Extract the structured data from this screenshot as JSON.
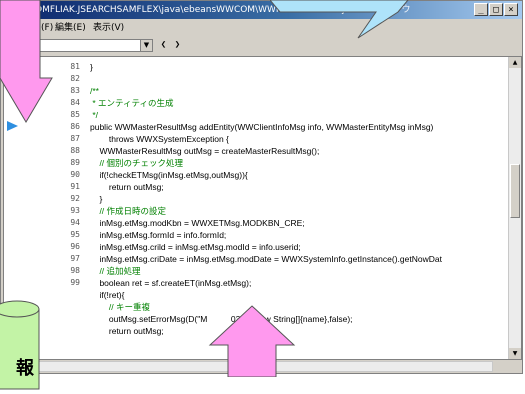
{
  "window": {
    "title": "OMFLIAK.JSEARCHSAMFLEX\\java\\ebeansWWCOM\\WWMasterInvoker.java",
    "title_suffix": "ソースウィンドウ",
    "minimize": "_",
    "maximize": "□",
    "close": "×"
  },
  "menu": [
    {
      "label": "ファイル(F)"
    },
    {
      "label": "編集(E)"
    },
    {
      "label": "表示(V)"
    }
  ],
  "toolbar": {
    "combo_value": "",
    "combo_arrow": "▼",
    "btn_prev": "❮",
    "btn_next": "❯"
  },
  "editor": {
    "current_line": "85",
    "lines": [
      {
        "no": "81",
        "text": "}",
        "type": "code"
      },
      {
        "no": "82",
        "text": "",
        "type": "code"
      },
      {
        "no": "83",
        "text": "/**",
        "type": "comment"
      },
      {
        "no": "84",
        "text": " * エンティティの生成",
        "type": "comment"
      },
      {
        "no": "85",
        "text": " */",
        "type": "comment"
      },
      {
        "no": "86",
        "text": "public WWMasterResultMsg addEntity(WWClientInfoMsg info, WWMasterEntityMsg inMsg)",
        "type": "code"
      },
      {
        "no": "87",
        "text": "        throws WWXSystemException {",
        "type": "code"
      },
      {
        "no": "88",
        "text": "    WWMasterResultMsg outMsg = createMasterResultMsg();",
        "type": "code"
      },
      {
        "no": "89",
        "text": "    // 個別のチェック処理",
        "type": "comment"
      },
      {
        "no": "90",
        "text": "    if(!checkETMsg(inMsg.etMsg,outMsg)){",
        "type": "code"
      },
      {
        "no": "91",
        "text": "        return outMsg;",
        "type": "code"
      },
      {
        "no": "92",
        "text": "    }",
        "type": "code"
      },
      {
        "no": "93",
        "text": "    // 作成日時の設定",
        "type": "comment"
      },
      {
        "no": "94",
        "text": "    inMsg.etMsg.modKbn = WWXETMsg.MODKBN_CRE;",
        "type": "code"
      },
      {
        "no": "95",
        "text": "    inMsg.etMsg.formId = info.formId;",
        "type": "code"
      },
      {
        "no": "96",
        "text": "    inMsg.etMsg.crild = inMsg.etMsg.modId = info.userid;",
        "type": "code"
      },
      {
        "no": "97",
        "text": "    inMsg.etMsg.criDate = inMsg.etMsg.modDate = WWXSystemInfo.getInstance().getNowDat",
        "type": "code"
      },
      {
        "no": "98",
        "text": "    // 追加処理",
        "type": "comment"
      },
      {
        "no": "99",
        "text": "    boolean ret = sf.createET(inMsg.etMsg);",
        "type": "code"
      },
      {
        "no": "",
        "text": "    if(!ret){",
        "type": "code"
      },
      {
        "no": "",
        "text": "        // キー重複",
        "type": "comment"
      },
      {
        "no": "",
        "text": "        outMsg.setErrorMsg(D(\"M          0320\",new String[]{name},false);",
        "type": "code"
      },
      {
        "no": "",
        "text": "        return outMsg;",
        "type": "code"
      },
      {
        "no": "",
        "text": "",
        "type": "code"
      }
    ]
  },
  "overlay": {
    "db_label": "報"
  },
  "colors": {
    "callout_fill": "#ff99ee",
    "bubble_fill": "#aee3fa",
    "db_fill": "#c3f3a6",
    "comment": "#008000",
    "marker": "#2e8fe0"
  }
}
